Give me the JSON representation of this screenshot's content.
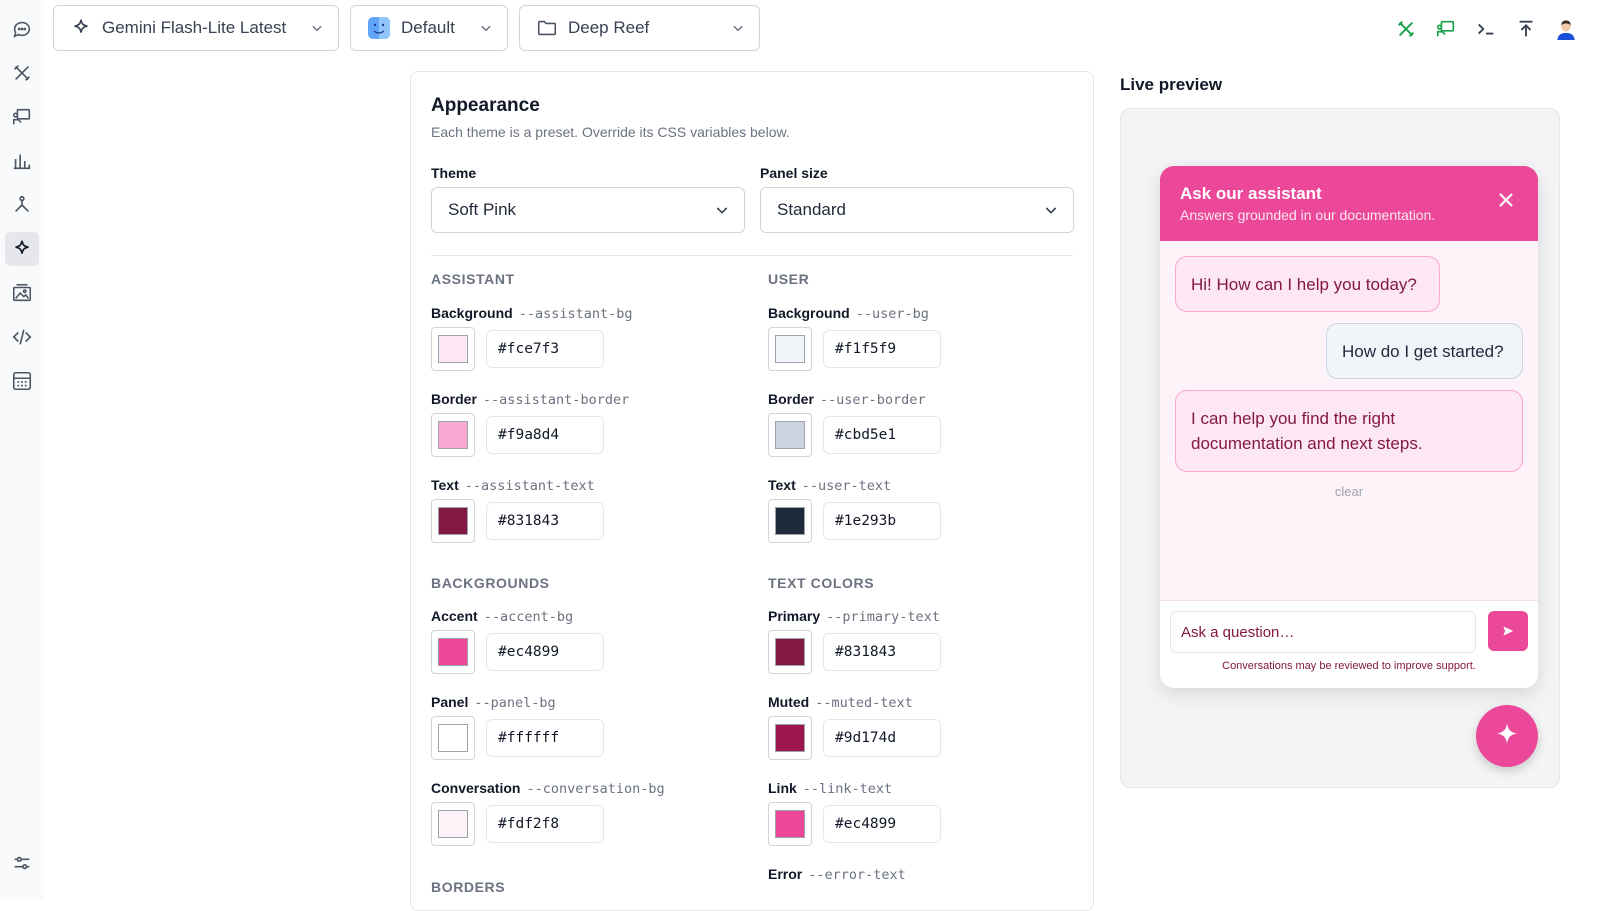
{
  "toolbar": {
    "model": "Gemini Flash-Lite Latest",
    "profile": "Default",
    "project": "Deep Reef"
  },
  "rail": {
    "icons": [
      "chat-icon",
      "tools-icon",
      "presentation-icon",
      "bar-chart-icon",
      "fork-icon",
      "sparkle-icon",
      "image-gallery-icon",
      "code-icon",
      "calculator-icon",
      "sliders-icon"
    ],
    "active": "sparkle-icon"
  },
  "appearance": {
    "title": "Appearance",
    "subtitle": "Each theme is a preset. Override its CSS variables below.",
    "theme_label": "Theme",
    "theme_value": "Soft Pink",
    "panel_label": "Panel size",
    "panel_value": "Standard"
  },
  "sections": {
    "assistant": "ASSISTANT",
    "user": "USER",
    "backgrounds": "BACKGROUNDS",
    "text_colors": "TEXT COLORS",
    "borders": "BORDERS"
  },
  "vars": {
    "assistant_bg": {
      "label": "Background",
      "var": "--assistant-bg",
      "hex": "#fce7f3"
    },
    "assistant_border": {
      "label": "Border",
      "var": "--assistant-border",
      "hex": "#f9a8d4"
    },
    "assistant_text": {
      "label": "Text",
      "var": "--assistant-text",
      "hex": "#831843"
    },
    "user_bg": {
      "label": "Background",
      "var": "--user-bg",
      "hex": "#f1f5f9"
    },
    "user_border": {
      "label": "Border",
      "var": "--user-border",
      "hex": "#cbd5e1"
    },
    "user_text": {
      "label": "Text",
      "var": "--user-text",
      "hex": "#1e293b"
    },
    "accent_bg": {
      "label": "Accent",
      "var": "--accent-bg",
      "hex": "#ec4899"
    },
    "panel_bg": {
      "label": "Panel",
      "var": "--panel-bg",
      "hex": "#ffffff"
    },
    "conversation_bg": {
      "label": "Conversation",
      "var": "--conversation-bg",
      "hex": "#fdf2f8"
    },
    "primary_text": {
      "label": "Primary",
      "var": "--primary-text",
      "hex": "#831843"
    },
    "muted_text": {
      "label": "Muted",
      "var": "--muted-text",
      "hex": "#9d174d"
    },
    "link_text": {
      "label": "Link",
      "var": "--link-text",
      "hex": "#ec4899"
    },
    "error_text": {
      "label": "Error",
      "var": "--error-text"
    }
  },
  "preview": {
    "title": "Live preview",
    "header_title": "Ask our assistant",
    "header_sub": "Answers grounded in our documentation.",
    "msg1": "Hi! How can I help you today?",
    "msg2": "How do I get started?",
    "msg3": "I can help you find the right documentation and next steps.",
    "clear": "clear",
    "input_placeholder": "Ask a question…",
    "footer_note": "Conversations may be reviewed to improve support."
  }
}
